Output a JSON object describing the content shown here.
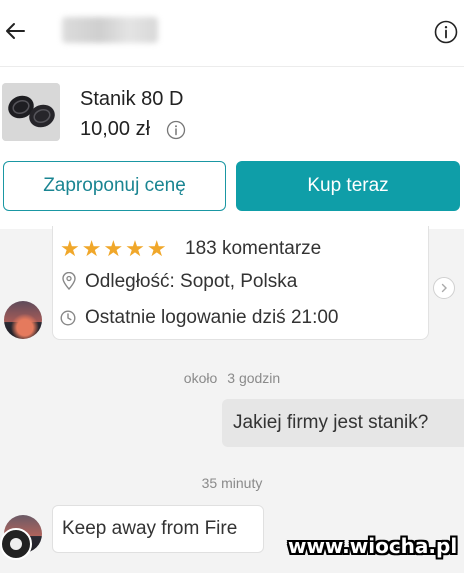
{
  "header": {
    "back_icon": "arrow-left-icon",
    "info_icon": "info-circle-icon"
  },
  "item": {
    "title": "Stanik 80 D",
    "price": "10,00 zł",
    "price_info_icon": "info-circle-icon"
  },
  "actions": {
    "offer_label": "Zaproponuj cenę",
    "buy_label": "Kup teraz"
  },
  "profile": {
    "stars": "★★★★★",
    "rating": 5,
    "reviews": "183 komentarze",
    "location": "Odległość: Sopot, Polska",
    "last_login": "Ostatnie logowanie dziś 21:00"
  },
  "chat": {
    "timestamp_1_prefix": "około",
    "timestamp_1_value": "3 godzin",
    "message_out": "Jakiej firmy jest stanik?",
    "timestamp_2": "35 minuty",
    "message_in": "Keep away from Fire"
  },
  "watermark": "www.wiocha.pl",
  "colors": {
    "accent": "#0f9ea8",
    "star": "#f0a72a",
    "background": "#f3f3f3"
  }
}
